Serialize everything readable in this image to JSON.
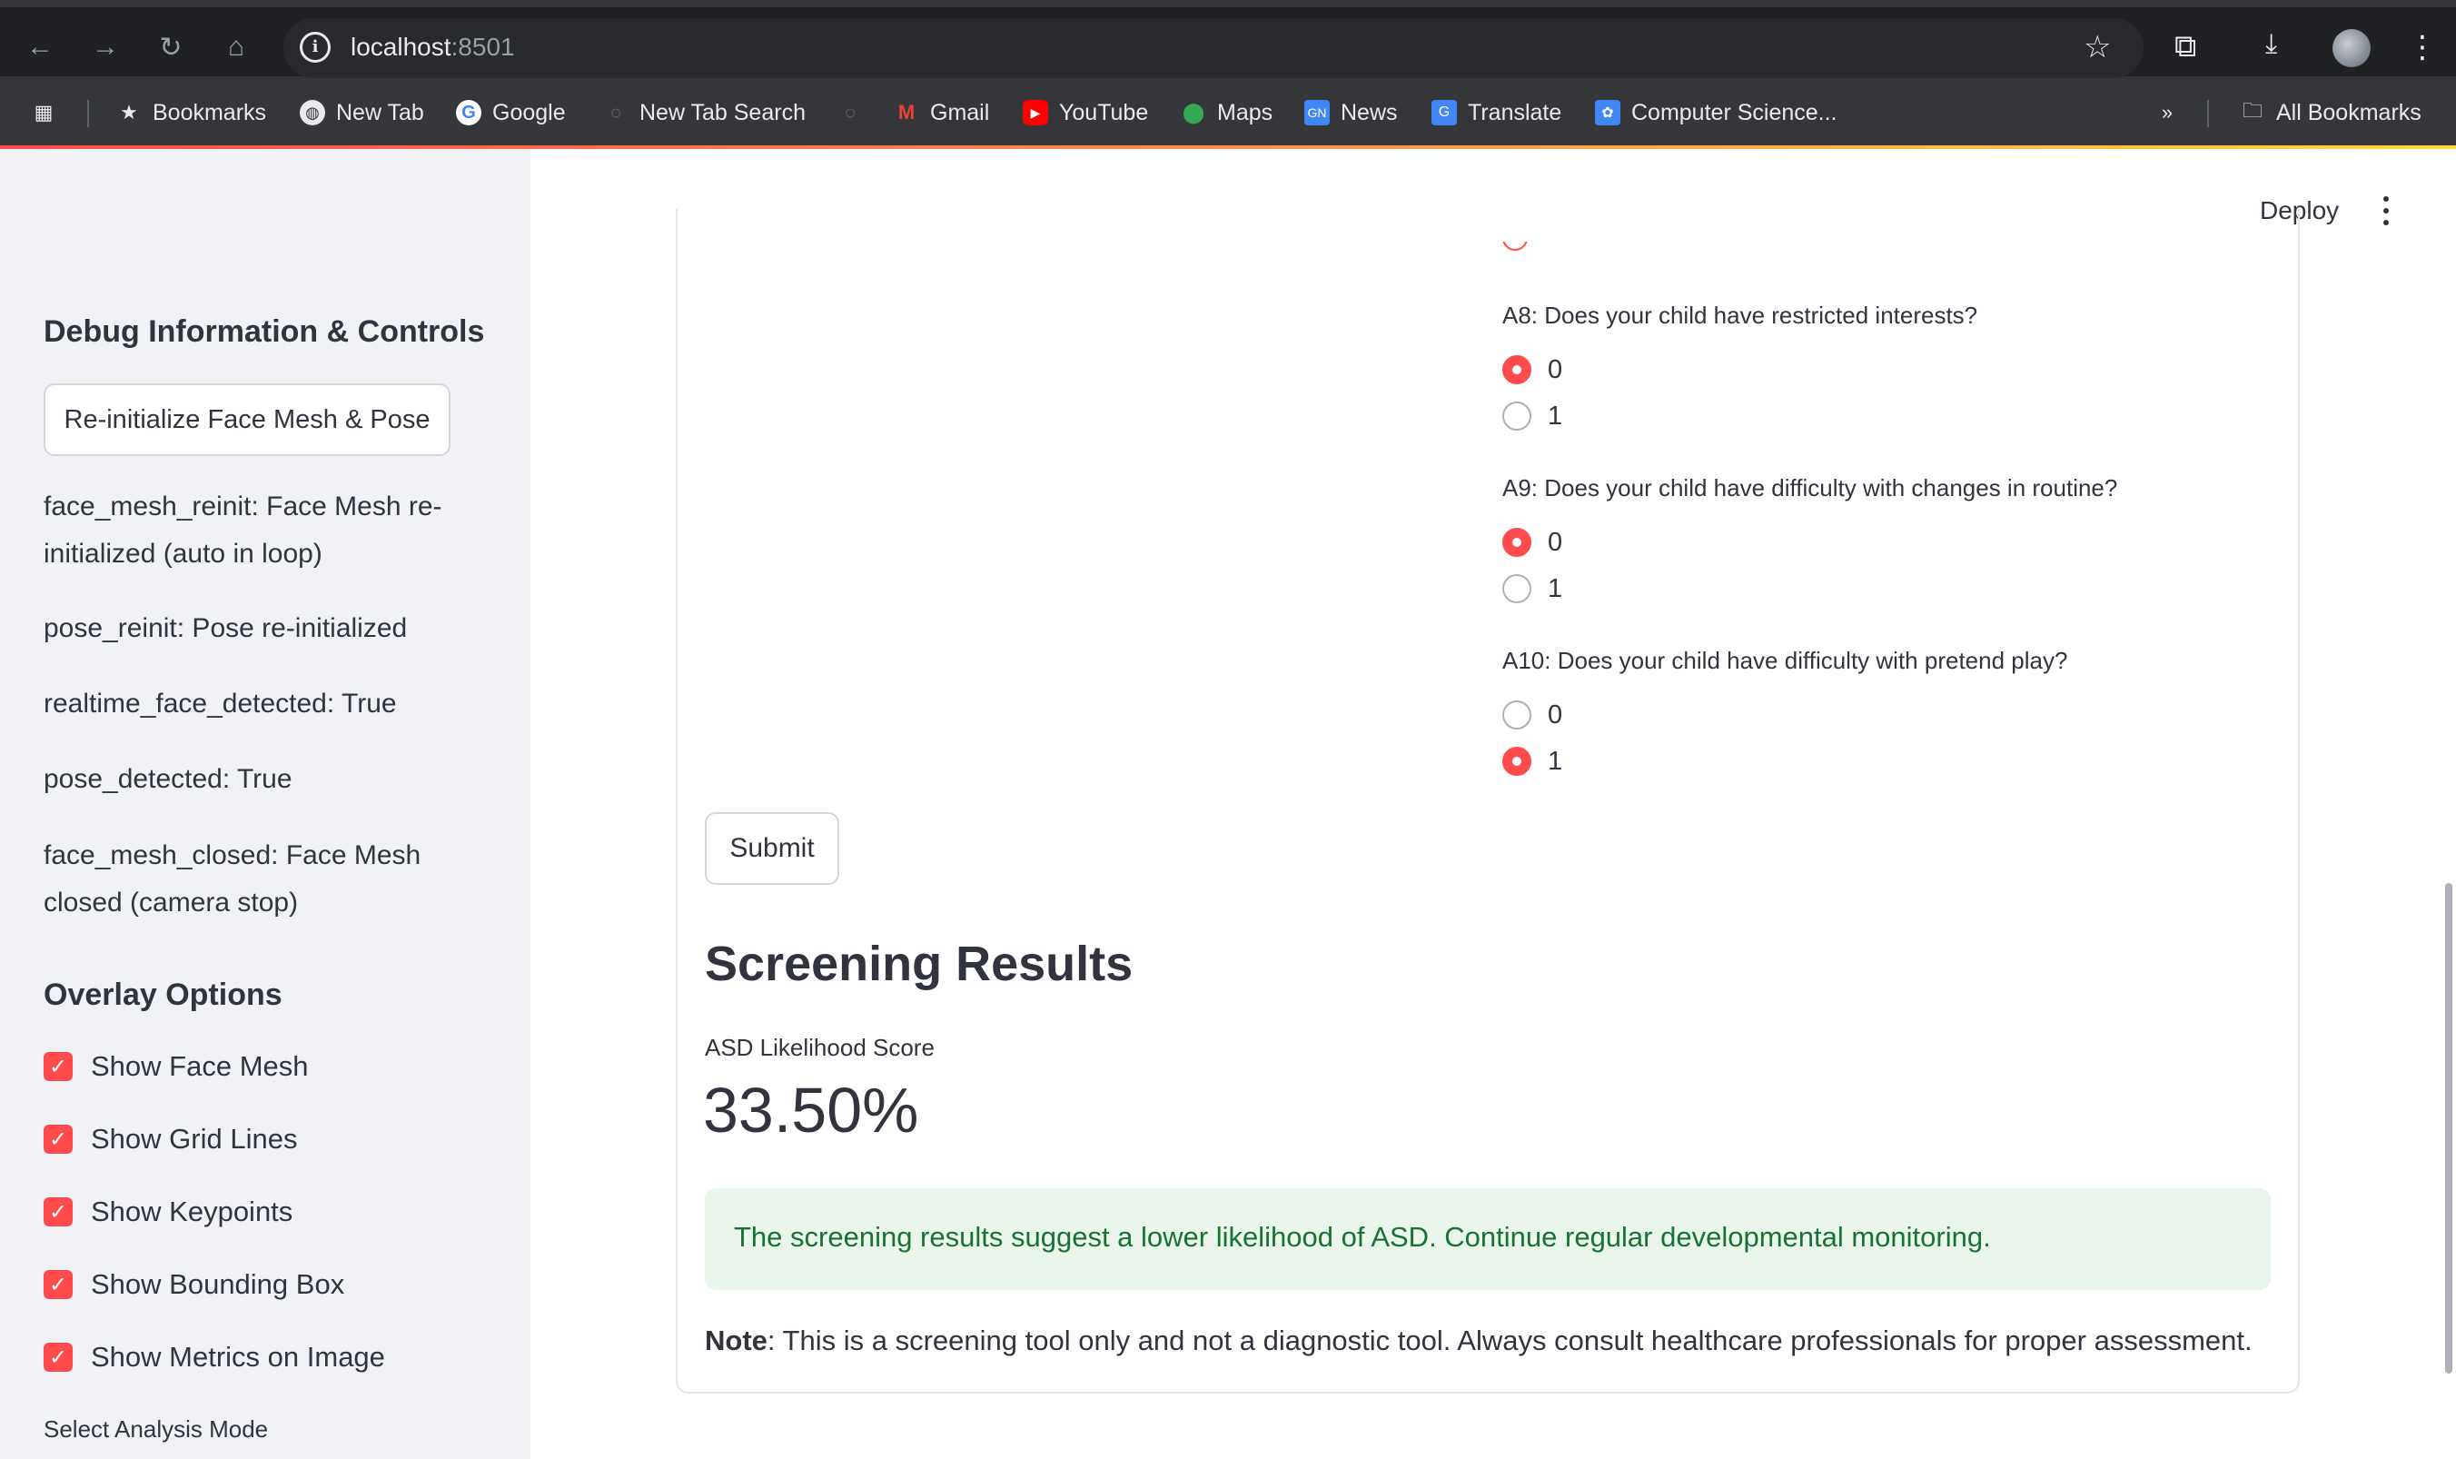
{
  "browser": {
    "url_host": "localhost",
    "url_port": ":8501",
    "bookmarks": [
      {
        "label": "Bookmarks",
        "icon": "star-icon"
      },
      {
        "label": "New Tab",
        "icon": "globe-icon"
      },
      {
        "label": "Google",
        "icon": "google-icon"
      },
      {
        "label": "New Tab Search",
        "icon": "search-icon"
      },
      {
        "label": "Gmail",
        "icon": "gmail-icon"
      },
      {
        "label": "YouTube",
        "icon": "youtube-icon"
      },
      {
        "label": "Maps",
        "icon": "maps-icon"
      },
      {
        "label": "News",
        "icon": "news-icon"
      },
      {
        "label": "Translate",
        "icon": "translate-icon"
      },
      {
        "label": "Computer Science...",
        "icon": "cs-icon"
      }
    ],
    "all_bookmarks": "All Bookmarks"
  },
  "sidebar": {
    "debug_heading": "Debug Information & Controls",
    "reinit_button": "Re-initialize Face Mesh & Pose",
    "debug_lines": [
      "face_mesh_reinit: Face Mesh re-initialized (auto in loop)",
      "pose_reinit: Pose re-initialized",
      "realtime_face_detected: True",
      "pose_detected: True",
      "face_mesh_closed: Face Mesh closed (camera stop)"
    ],
    "overlay_heading": "Overlay Options",
    "overlay_options": [
      {
        "label": "Show Face Mesh",
        "checked": true
      },
      {
        "label": "Show Grid Lines",
        "checked": true
      },
      {
        "label": "Show Keypoints",
        "checked": true
      },
      {
        "label": "Show Bounding Box",
        "checked": true
      },
      {
        "label": "Show Metrics on Image",
        "checked": true
      }
    ],
    "analysis_mode_label": "Select Analysis Mode"
  },
  "header": {
    "deploy": "Deploy"
  },
  "questions": [
    {
      "label": "A8: Does your child have restricted interests?",
      "options": [
        "0",
        "1"
      ],
      "selected": "0"
    },
    {
      "label": "A9: Does your child have difficulty with changes in routine?",
      "options": [
        "0",
        "1"
      ],
      "selected": "0"
    },
    {
      "label": "A10: Does your child have difficulty with pretend play?",
      "options": [
        "0",
        "1"
      ],
      "selected": "1"
    }
  ],
  "form": {
    "submit": "Submit"
  },
  "results": {
    "heading": "Screening Results",
    "metric_label": "ASD Likelihood Score",
    "metric_value": "33.50%",
    "success_message": "The screening results suggest a lower likelihood of ASD. Continue regular developmental monitoring.",
    "note_bold": "Note",
    "note_text": ": This is a screening tool only and not a diagnostic tool. Always consult healthcare professionals for proper assessment."
  },
  "colors": {
    "accent": "#ff4b4b",
    "success_bg": "#eaf6ec",
    "success_text": "#177233",
    "sidebar_bg": "#f0f2f6"
  }
}
